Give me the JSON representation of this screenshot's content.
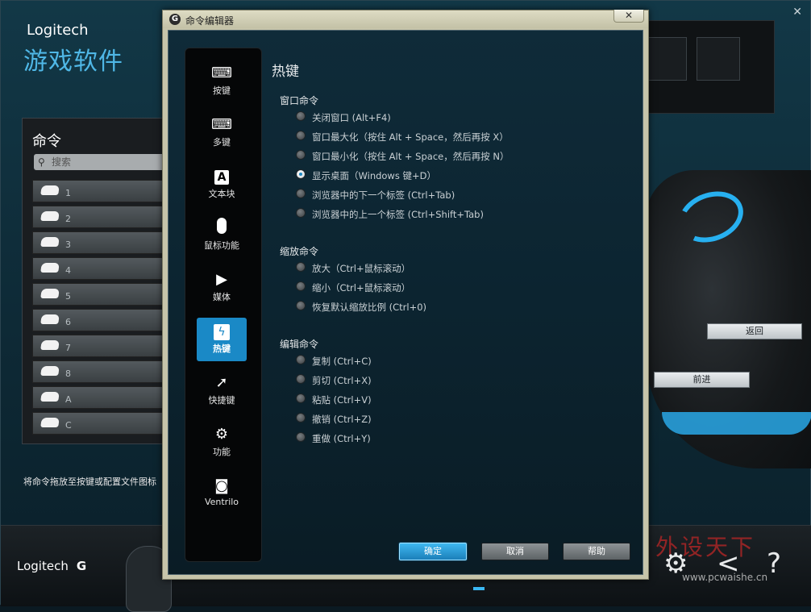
{
  "app": {
    "brand": "Logitech",
    "title": "游戏软件",
    "close": "✕",
    "commands_panel": {
      "title": "命令",
      "search_placeholder": "搜索",
      "items": [
        "1",
        "2",
        "3",
        "4",
        "5",
        "6",
        "7",
        "8",
        "A",
        "C"
      ]
    },
    "hint": "将命令拖放至按键或配置文件图标",
    "side_buttons": {
      "back": "返回",
      "forward": "前进"
    },
    "bottom": {
      "logo": "Logitech",
      "g_mark": "G",
      "watermark": "外设天下",
      "watermark_url": "www.pcwaishe.cn"
    }
  },
  "dialog": {
    "title": "命令编辑器",
    "close": "✕",
    "nav": [
      {
        "label": "按键",
        "icon": "key-icon"
      },
      {
        "label": "多键",
        "icon": "multikey-icon"
      },
      {
        "label": "文本块",
        "icon": "text-block-icon"
      },
      {
        "label": "鼠标功能",
        "icon": "mouse-icon"
      },
      {
        "label": "媒体",
        "icon": "play-icon"
      },
      {
        "label": "热键",
        "icon": "hotkey-icon"
      },
      {
        "label": "快捷键",
        "icon": "shortcut-arrow-icon"
      },
      {
        "label": "功能",
        "icon": "function-gear-icon"
      },
      {
        "label": "Ventrilo",
        "icon": "headset-icon"
      }
    ],
    "active_nav": "热键",
    "section_title": "热键",
    "groups": [
      {
        "title": "窗口命令",
        "options": [
          "关闭窗口 (Alt+F4)",
          "窗口最大化（按住 Alt + Space，然后再按 X）",
          "窗口最小化（按住 Alt + Space，然后再按 N）",
          "显示桌面（Windows 键+D）",
          "浏览器中的下一个标签 (Ctrl+Tab)",
          "浏览器中的上一个标签 (Ctrl+Shift+Tab)"
        ]
      },
      {
        "title": "缩放命令",
        "options": [
          "放大（Ctrl+鼠标滚动）",
          "缩小（Ctrl+鼠标滚动）",
          "恢复默认缩放比例 (Ctrl+0)"
        ]
      },
      {
        "title": "编辑命令",
        "options": [
          "复制 (Ctrl+C)",
          "剪切 (Ctrl+X)",
          "粘贴 (Ctrl+V)",
          "撤销 (Ctrl+Z)",
          "重做 (Ctrl+Y)"
        ]
      }
    ],
    "selected_option": "显示桌面（Windows 键+D）",
    "buttons": {
      "ok": "确定",
      "cancel": "取消",
      "help": "帮助"
    }
  }
}
